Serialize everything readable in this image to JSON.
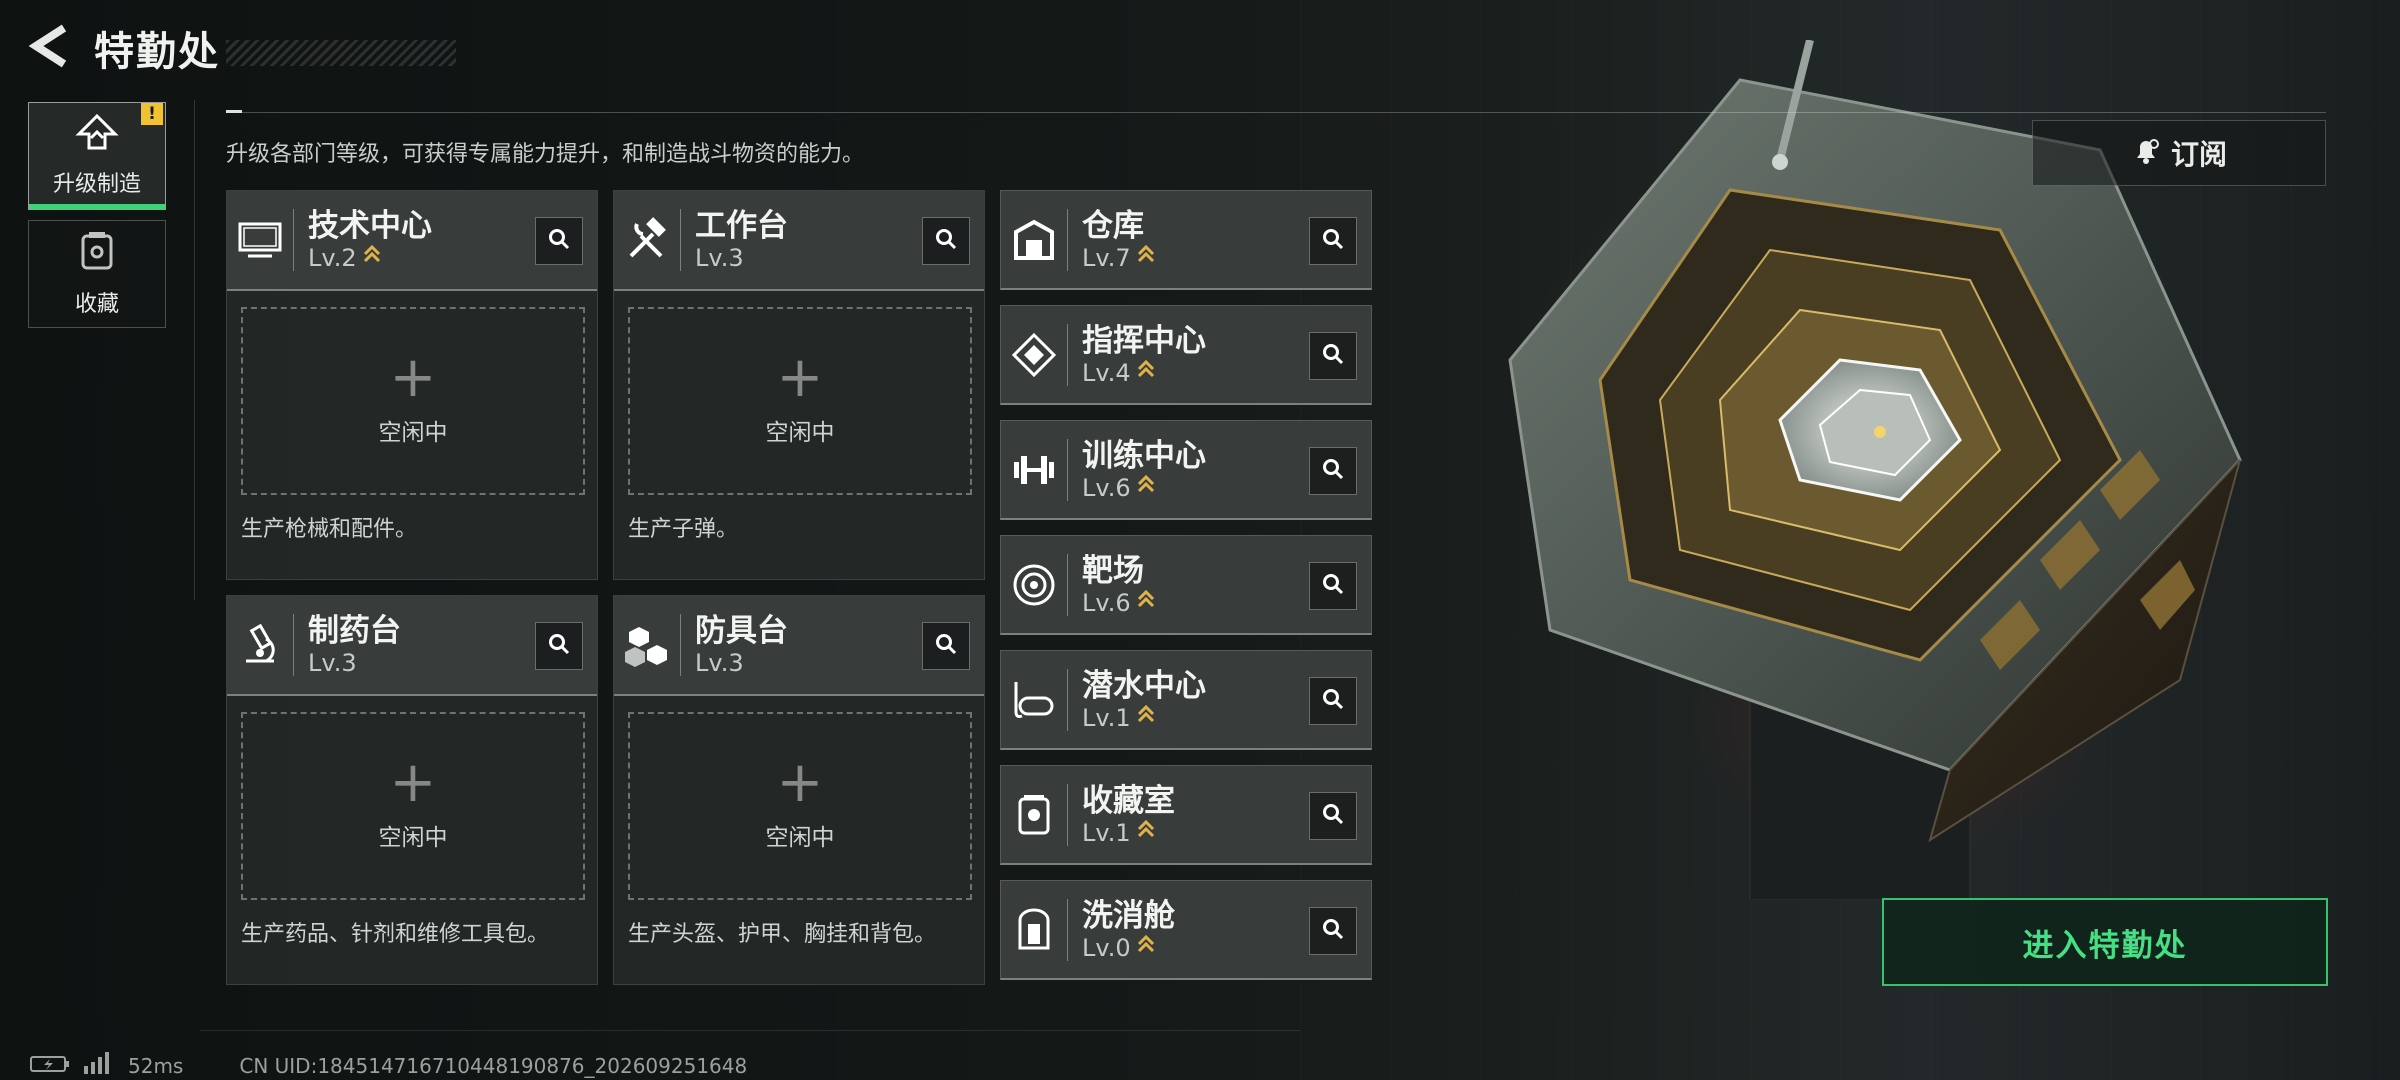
{
  "header": {
    "title": "特勤处"
  },
  "sidebar": {
    "items": [
      {
        "label": "升级制造",
        "badge": "!",
        "active": true
      },
      {
        "label": "收藏",
        "active": false
      }
    ]
  },
  "description": "升级各部门等级，可获得专属能力提升，和制造战斗物资的能力。",
  "subscribe_label": "订阅",
  "production_departments": [
    {
      "name": "技术中心",
      "level": "Lv.2",
      "slot_status": "空闲中",
      "slot_plus": "+",
      "desc": "生产枪械和配件。",
      "icon": "monitor-icon"
    },
    {
      "name": "工作台",
      "level": "Lv.3",
      "slot_status": "空闲中",
      "slot_plus": "+",
      "desc": "生产子弹。",
      "icon": "hammer-wrench-icon"
    },
    {
      "name": "制药台",
      "level": "Lv.3",
      "slot_status": "空闲中",
      "slot_plus": "+",
      "desc": "生产药品、针剂和维修工具包。",
      "icon": "microscope-icon"
    },
    {
      "name": "防具台",
      "level": "Lv.3",
      "slot_status": "空闲中",
      "slot_plus": "+",
      "desc": "生产头盔、护甲、胸挂和背包。",
      "icon": "boxes-icon"
    }
  ],
  "other_departments": [
    {
      "name": "仓库",
      "level": "Lv.7",
      "icon": "warehouse-icon"
    },
    {
      "name": "指挥中心",
      "level": "Lv.4",
      "icon": "command-diamond-icon"
    },
    {
      "name": "训练中心",
      "level": "Lv.6",
      "icon": "dumbbell-icon"
    },
    {
      "name": "靶场",
      "level": "Lv.6",
      "icon": "target-icon"
    },
    {
      "name": "潜水中心",
      "level": "Lv.1",
      "icon": "diving-mask-icon"
    },
    {
      "name": "收藏室",
      "level": "Lv.1",
      "icon": "display-case-icon"
    },
    {
      "name": "洗消舱",
      "level": "Lv.0",
      "icon": "decon-chamber-icon"
    }
  ],
  "enter_button": "进入特勤处",
  "status": {
    "ping": "52ms",
    "uid": "CN UID:18451471671044819087​6_202609251648"
  },
  "colors": {
    "accent_green": "#3fd27a",
    "upgrade_gold": "#e0b34a",
    "badge_yellow": "#f1c232"
  }
}
